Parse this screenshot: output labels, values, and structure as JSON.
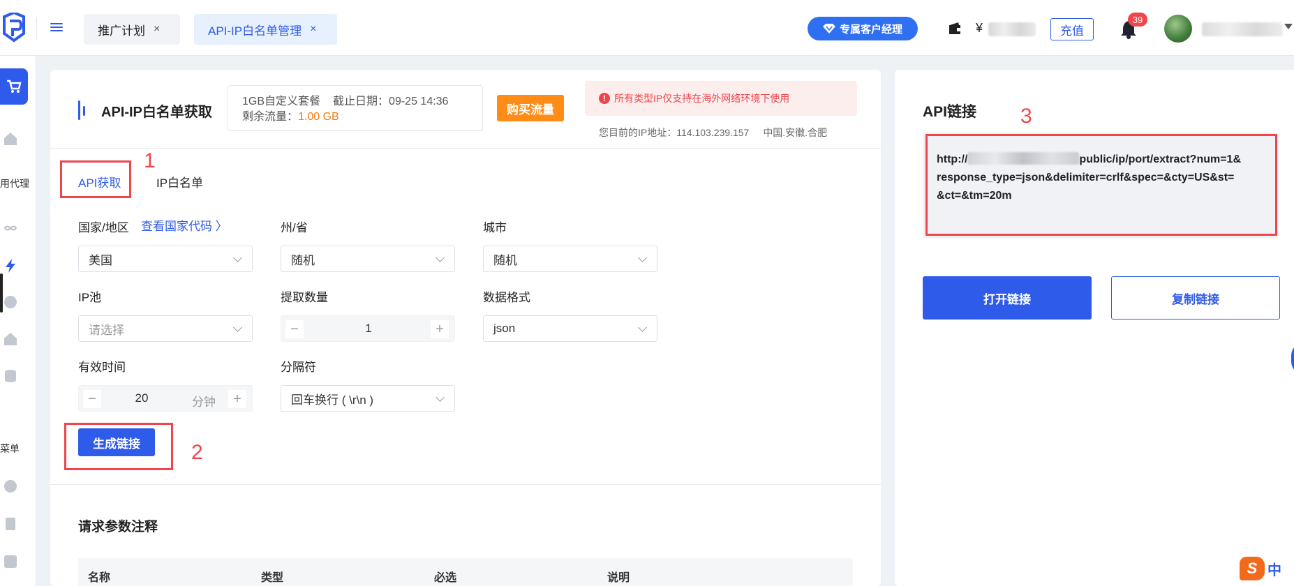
{
  "colors": {
    "accent": "#2f5bea",
    "orange": "#ff8c17",
    "danger": "#f0454c",
    "bg": "#eef1f6"
  },
  "header": {
    "tabs": [
      {
        "label": "推广计划",
        "close": "×"
      },
      {
        "label": "API-IP白名单管理",
        "close": "×"
      }
    ],
    "manager_label": "专属客户经理",
    "currency": "¥",
    "recharge_label": "充值",
    "notification_count": "39"
  },
  "sidebar": {
    "labels": [
      "用代理",
      "菜单"
    ],
    "icons": [
      "cart-icon",
      "home-icon",
      "infinity-icon",
      "lightning-icon",
      "coin-icon",
      "house-icon",
      "database-icon",
      "yen-icon",
      "ticket-icon",
      "translate-icon"
    ]
  },
  "main": {
    "title": "API-IP白名单获取",
    "plan": {
      "name": "1GB自定义套餐",
      "expiry_label": "截止日期：",
      "expiry_value": "09-25 14:36",
      "remaining_label": "剩余流量：",
      "remaining_value": "1.00 GB"
    },
    "buy_label": "购买流量",
    "notice": "所有类型IP仅支持在海外网络环境下使用",
    "ip_label": "您目前的IP地址：",
    "ip_value": "114.103.239.157",
    "ip_location": "中国.安徽.合肥",
    "subtabs": [
      "API获取",
      "IP白名单"
    ],
    "form": {
      "country_label": "国家/地区",
      "country_link": "查看国家代码 〉",
      "country_value": "美国",
      "state_label": "州/省",
      "state_value": "随机",
      "city_label": "城市",
      "city_value": "随机",
      "pool_label": "IP池",
      "pool_placeholder": "请选择",
      "count_label": "提取数量",
      "count_value": "1",
      "format_label": "数据格式",
      "format_value": "json",
      "ttl_label": "有效时间",
      "ttl_value": "20",
      "ttl_unit": "分钟",
      "delimiter_label": "分隔符",
      "delimiter_value": "回车换行 ( \\r\\n )"
    },
    "generate_label": "生成链接",
    "params_title": "请求参数注释",
    "table_headers": [
      "名称",
      "类型",
      "必选",
      "说明"
    ]
  },
  "right": {
    "title": "API链接",
    "url_prefix": "http://",
    "url_suffix": "public/ip/port/extract?num=1&",
    "url_line2": "response_type=json&delimiter=crlf&spec=&cty=US&st=",
    "url_line3": "&ct=&tm=20m",
    "open_label": "打开链接",
    "copy_label": "复制链接"
  },
  "annotations": [
    "1",
    "2",
    "3"
  ],
  "ime": {
    "s": "S",
    "lang": "中"
  }
}
